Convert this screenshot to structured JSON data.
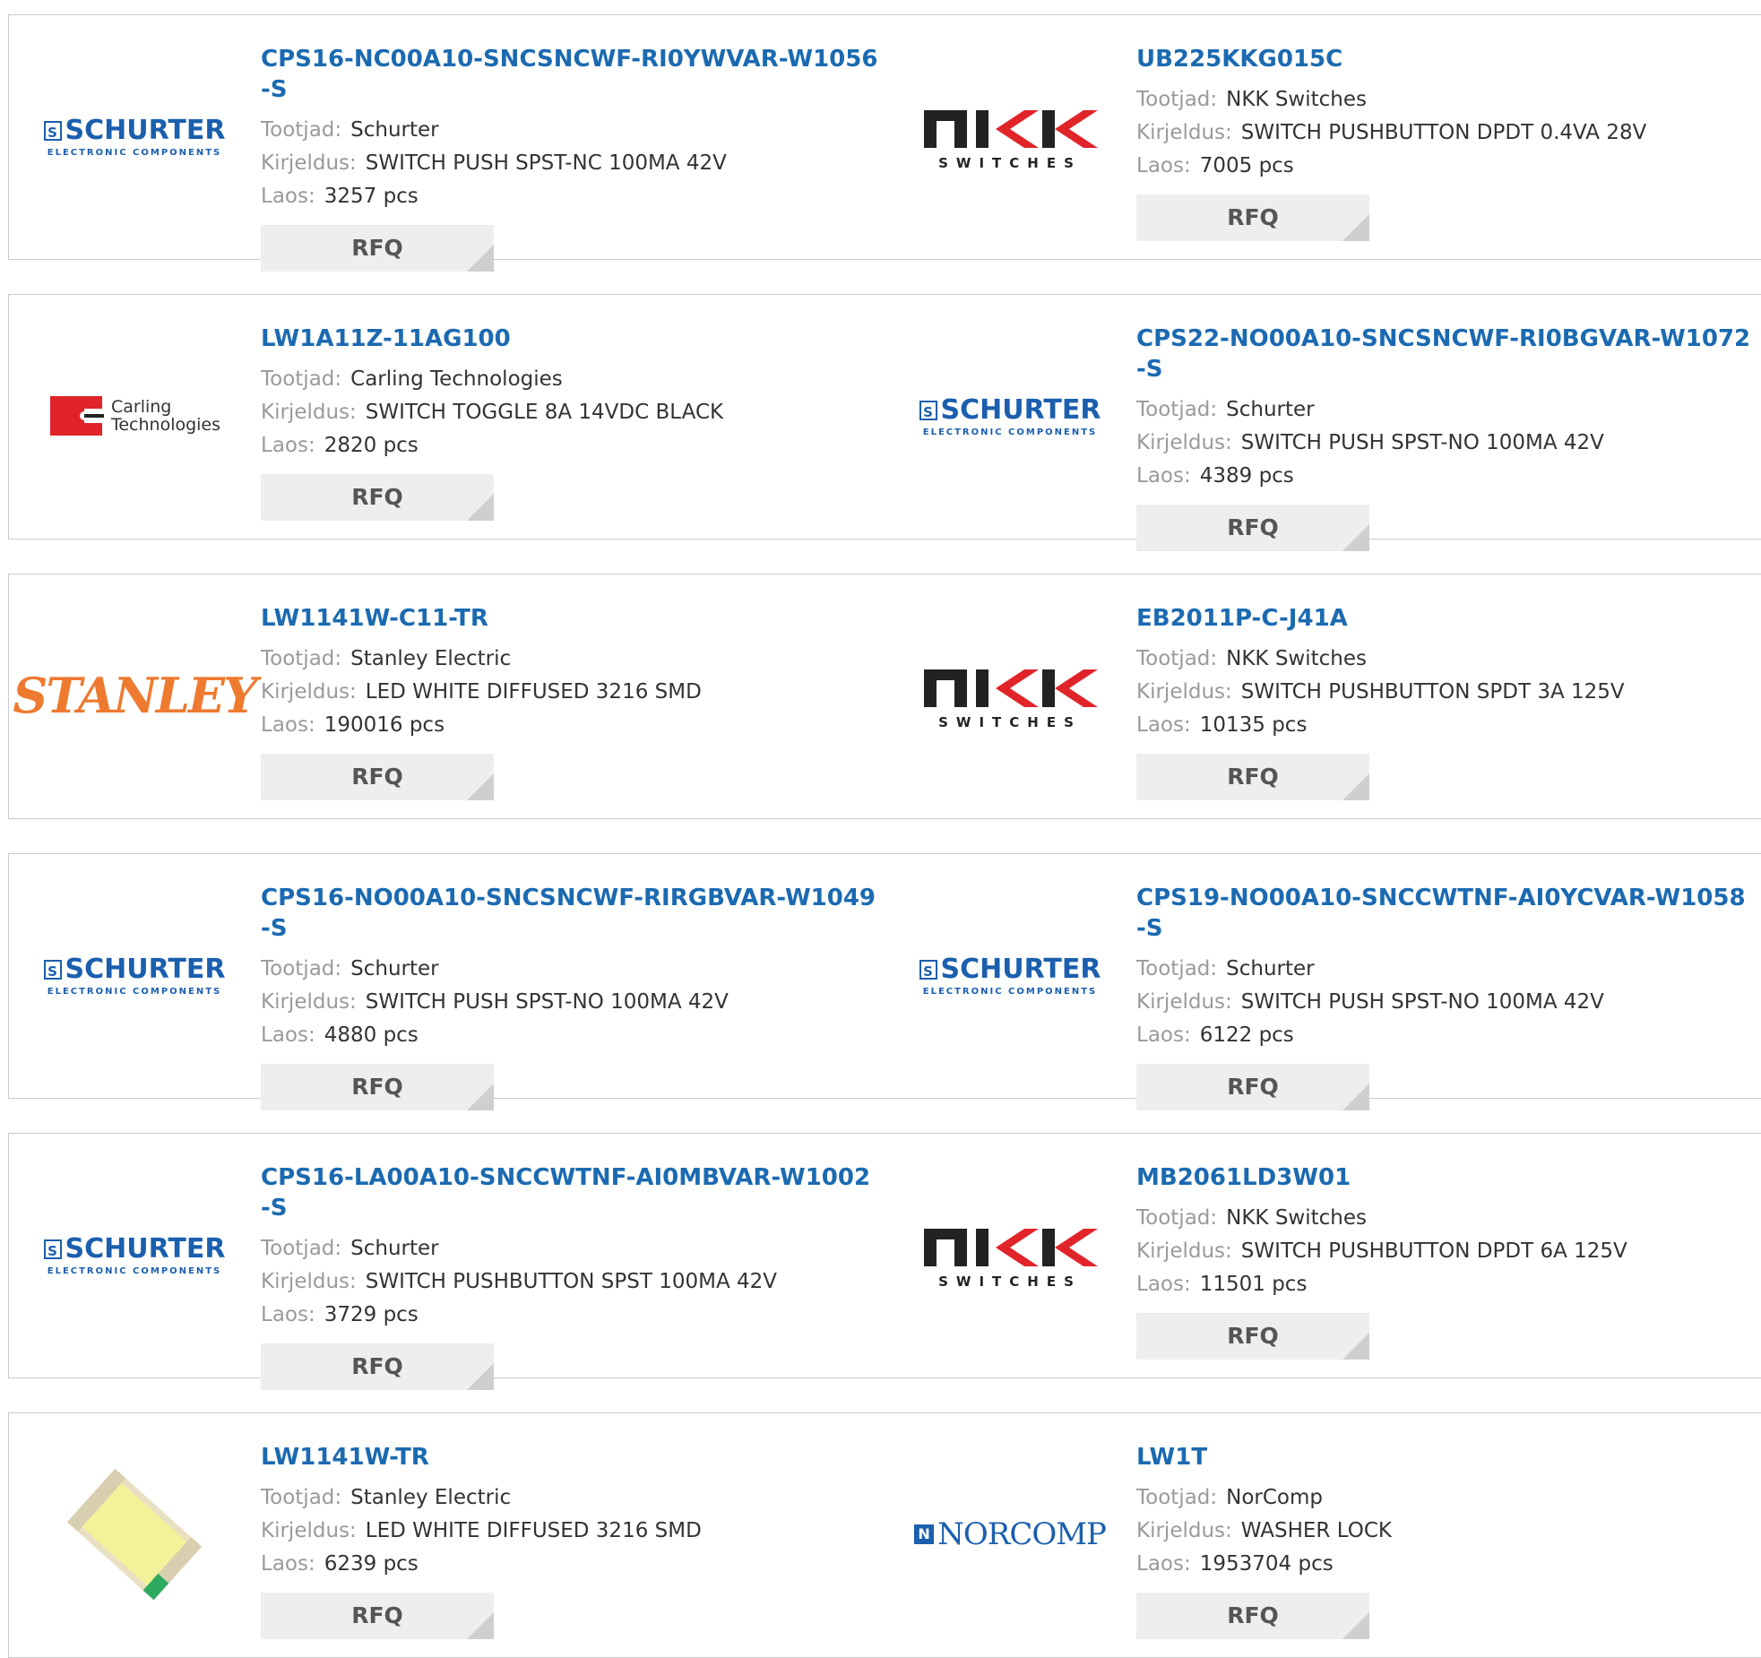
{
  "labels": {
    "manufacturer": "Tootjad:",
    "description": "Kirjeldus:",
    "stock": "Laos:",
    "rfq": "RFQ"
  },
  "products": [
    {
      "part": "CPS16-NC00A10-SNCSNCWF-RI0YWVAR-W1056-S",
      "manufacturer": "Schurter",
      "description": "SWITCH PUSH SPST-NC 100MA 42V",
      "stock": "3257 pcs",
      "logo": "schurter"
    },
    {
      "part": "UB225KKG015C",
      "manufacturer": "NKK Switches",
      "description": "SWITCH PUSHBUTTON DPDT 0.4VA 28V",
      "stock": "7005 pcs",
      "logo": "nkk"
    },
    {
      "part": "LW1A11Z-11AG100",
      "manufacturer": "Carling Technologies",
      "description": "SWITCH TOGGLE 8A 14VDC BLACK",
      "stock": "2820 pcs",
      "logo": "carling"
    },
    {
      "part": "CPS22-NO00A10-SNCSNCWF-RI0BGVAR-W1072-S",
      "manufacturer": "Schurter",
      "description": "SWITCH PUSH SPST-NO 100MA 42V",
      "stock": "4389 pcs",
      "logo": "schurter"
    },
    {
      "part": "LW1141W-C11-TR",
      "manufacturer": "Stanley Electric",
      "description": "LED WHITE DIFFUSED 3216 SMD",
      "stock": "190016 pcs",
      "logo": "stanley"
    },
    {
      "part": "EB2011P-C-J41A",
      "manufacturer": "NKK Switches",
      "description": "SWITCH PUSHBUTTON SPDT 3A 125V",
      "stock": "10135 pcs",
      "logo": "nkk"
    },
    {
      "part": "CPS16-NO00A10-SNCSNCWF-RIRGBVAR-W1049-S",
      "manufacturer": "Schurter",
      "description": "SWITCH PUSH SPST-NO 100MA 42V",
      "stock": "4880 pcs",
      "logo": "schurter"
    },
    {
      "part": "CPS19-NO00A10-SNCCWTNF-AI0YCVAR-W1058-S",
      "manufacturer": "Schurter",
      "description": "SWITCH PUSH SPST-NO 100MA 42V",
      "stock": "6122 pcs",
      "logo": "schurter"
    },
    {
      "part": "CPS16-LA00A10-SNCCWTNF-AI0MBVAR-W1002-S",
      "manufacturer": "Schurter",
      "description": "SWITCH PUSHBUTTON SPST 100MA 42V",
      "stock": "3729 pcs",
      "logo": "schurter"
    },
    {
      "part": "MB2061LD3W01",
      "manufacturer": "NKK Switches",
      "description": "SWITCH PUSHBUTTON DPDT 6A 125V",
      "stock": "11501 pcs",
      "logo": "nkk"
    },
    {
      "part": "LW1141W-TR",
      "manufacturer": "Stanley Electric",
      "description": "LED WHITE DIFFUSED 3216 SMD",
      "stock": "6239 pcs",
      "logo": "led-photo"
    },
    {
      "part": "LW1T",
      "manufacturer": "NorComp",
      "description": "WASHER LOCK",
      "stock": "1953704 pcs",
      "logo": "norcomp"
    }
  ],
  "logo_text": {
    "schurter": "SCHURTER",
    "schurter_sub": "ELECTRONIC COMPONENTS",
    "nkk_sub": "SWITCHES",
    "carling_line1": "Carling",
    "carling_line2": "Technologies",
    "stanley": "STANLEY",
    "norcomp": "NORCOMP"
  },
  "colors": {
    "link": "#1b6ab1",
    "label": "#9a9a9a",
    "value": "#333333",
    "rfq_bg": "#eeeeee",
    "border": "#c9c9c9"
  }
}
